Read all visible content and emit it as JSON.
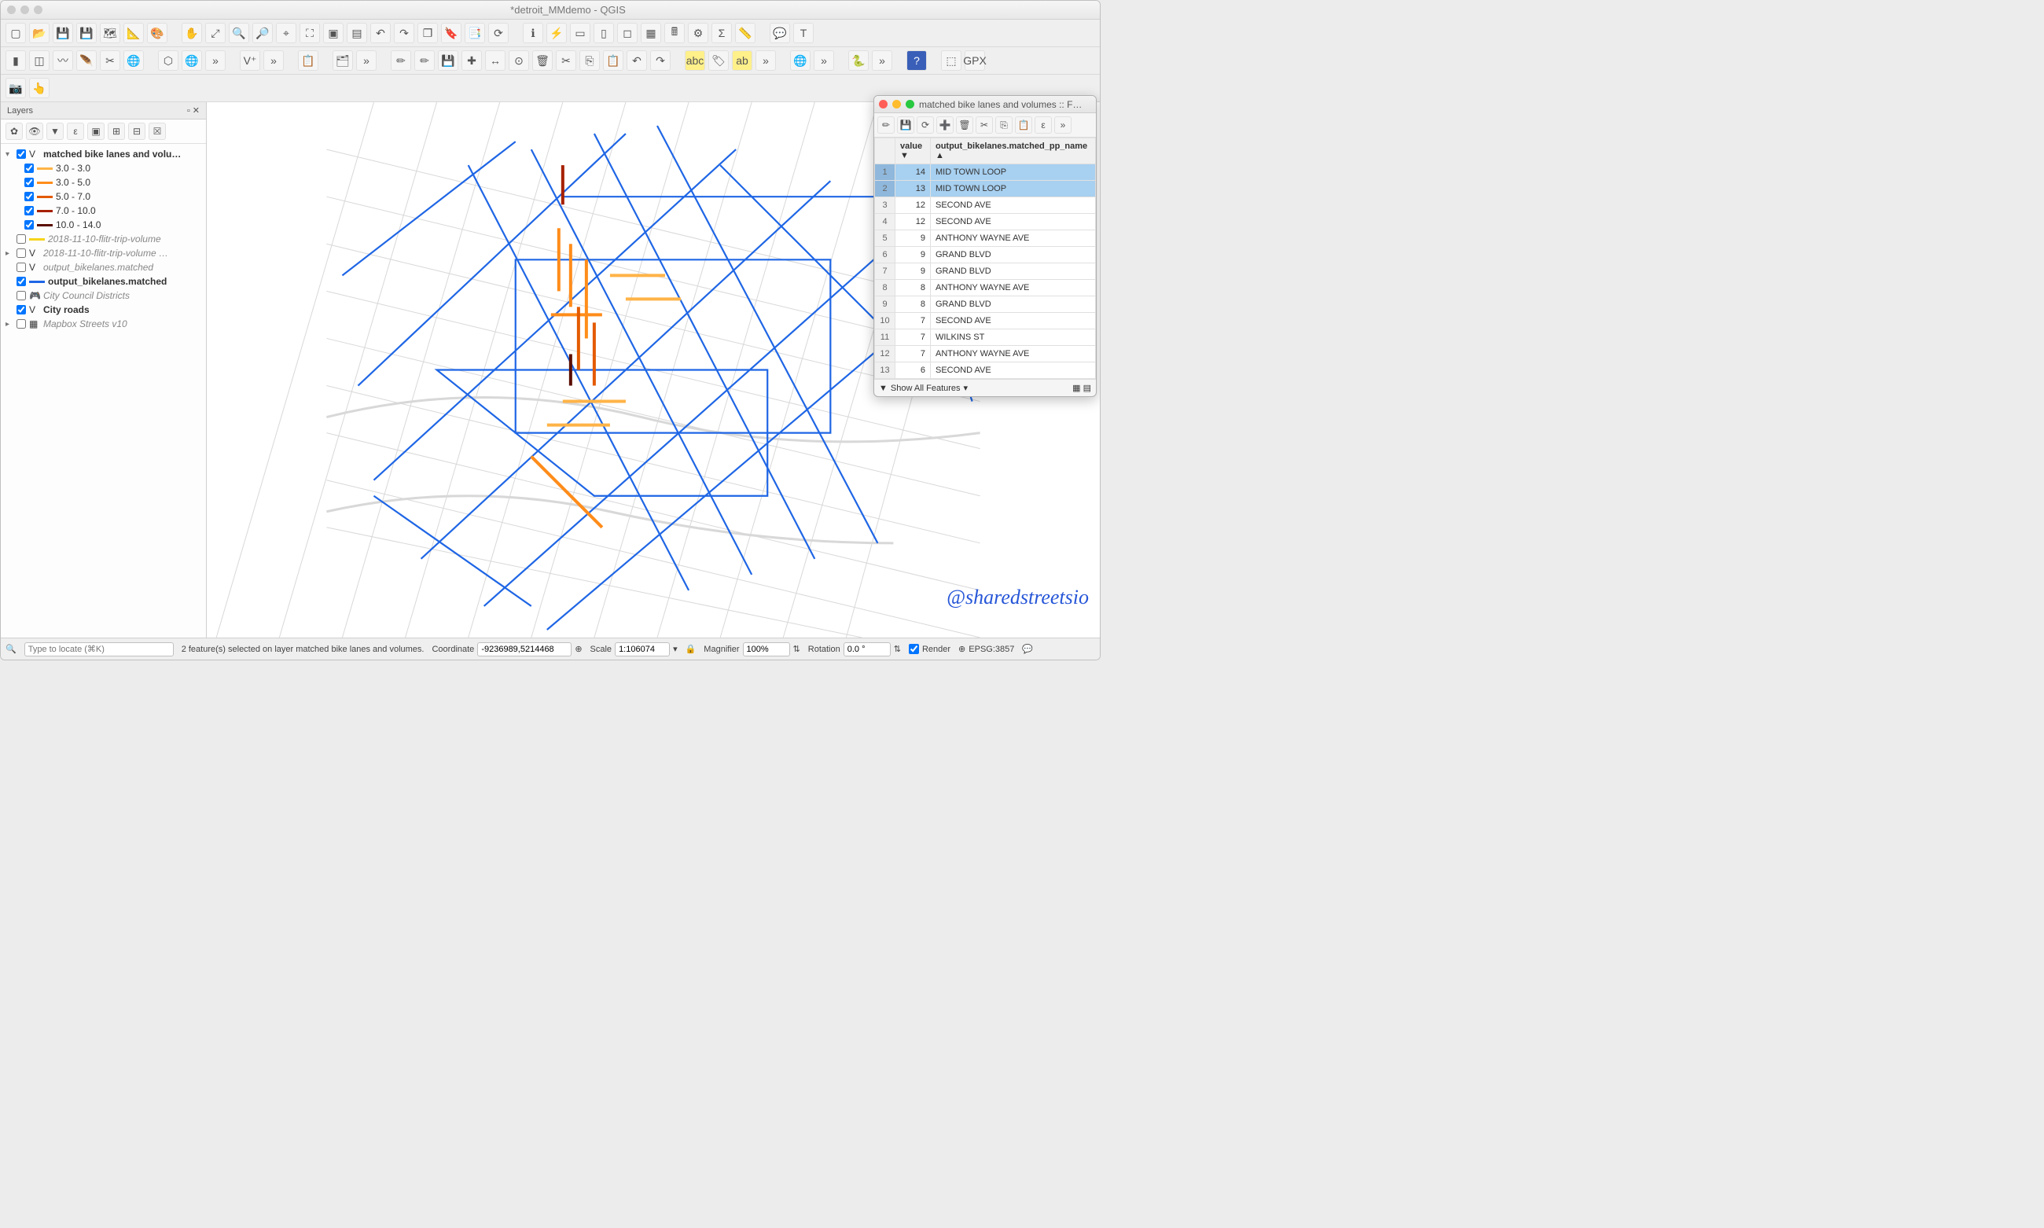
{
  "window_title": "*detroit_MMdemo - QGIS",
  "layers_panel": {
    "title": "Layers",
    "groups": [
      {
        "name": "matched bike lanes and volu…",
        "checked": true,
        "bold": true,
        "expanded": true,
        "items": [
          {
            "label": "3.0 - 3.0",
            "color": "#ffb347",
            "checked": true
          },
          {
            "label": "3.0 - 5.0",
            "color": "#ff8c1a",
            "checked": true
          },
          {
            "label": "5.0 - 7.0",
            "color": "#e35a00",
            "checked": true
          },
          {
            "label": "7.0 - 10.0",
            "color": "#a62000",
            "checked": true
          },
          {
            "label": "10.0 - 14.0",
            "color": "#5a0d00",
            "checked": true
          }
        ]
      },
      {
        "name": "2018-11-10-flitr-trip-volume",
        "checked": false,
        "italic": true,
        "swatch": "#f6d41b"
      },
      {
        "name": "2018-11-10-flitr-trip-volume …",
        "checked": false,
        "italic": true,
        "expandable": true
      },
      {
        "name": "output_bikelanes.matched",
        "checked": false,
        "italic": true
      },
      {
        "name": "output_bikelanes.matched",
        "checked": true,
        "bold": true,
        "swatch": "#1f66e5"
      },
      {
        "name": "City Council Districts",
        "checked": false,
        "italic": true,
        "icon": "db"
      },
      {
        "name": "City roads",
        "checked": true,
        "bold": true
      },
      {
        "name": "Mapbox Streets v10",
        "checked": false,
        "italic": true,
        "expandable": true,
        "icon": "raster"
      }
    ]
  },
  "attribute_window": {
    "title": "matched bike lanes and volumes :: F…",
    "col_value": "value",
    "col_name": "output_bikelanes.matched_pp_name",
    "rows": [
      {
        "n": 1,
        "v": 14,
        "name": "MID TOWN LOOP",
        "sel": true
      },
      {
        "n": 2,
        "v": 13,
        "name": "MID TOWN LOOP",
        "sel": true
      },
      {
        "n": 3,
        "v": 12,
        "name": "SECOND AVE"
      },
      {
        "n": 4,
        "v": 12,
        "name": "SECOND AVE"
      },
      {
        "n": 5,
        "v": 9,
        "name": "ANTHONY WAYNE AVE"
      },
      {
        "n": 6,
        "v": 9,
        "name": "GRAND BLVD"
      },
      {
        "n": 7,
        "v": 9,
        "name": "GRAND BLVD"
      },
      {
        "n": 8,
        "v": 8,
        "name": "ANTHONY WAYNE AVE"
      },
      {
        "n": 9,
        "v": 8,
        "name": "GRAND BLVD"
      },
      {
        "n": 10,
        "v": 7,
        "name": "SECOND AVE"
      },
      {
        "n": 11,
        "v": 7,
        "name": "WILKINS ST"
      },
      {
        "n": 12,
        "v": 7,
        "name": "ANTHONY WAYNE AVE"
      },
      {
        "n": 13,
        "v": 6,
        "name": "SECOND AVE"
      }
    ],
    "footer_label": "Show All Features"
  },
  "statusbar": {
    "locator_placeholder": "Type to locate (⌘K)",
    "selection_msg": "2 feature(s) selected on layer matched bike lanes and volumes.",
    "coord_label": "Coordinate",
    "coord_value": "-9236989,5214468",
    "scale_label": "Scale",
    "scale_value": "1:106074",
    "magnifier_label": "Magnifier",
    "magnifier_value": "100%",
    "rotation_label": "Rotation",
    "rotation_value": "0.0 °",
    "render_label": "Render",
    "crs_label": "EPSG:3857"
  },
  "watermark": "@sharedstreetsio"
}
